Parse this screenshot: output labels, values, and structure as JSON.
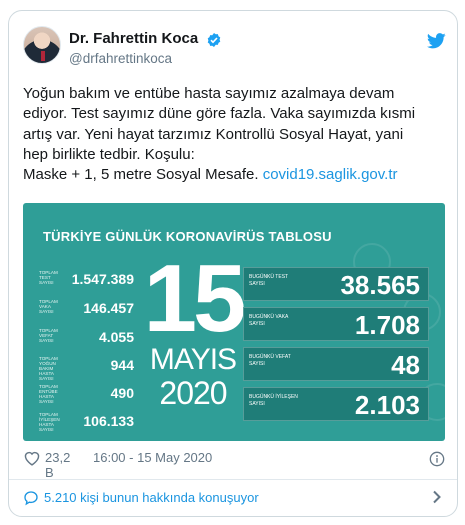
{
  "author": {
    "name": "Dr. Fahrettin Koca",
    "handle": "@drfahrettinkoca"
  },
  "tweet": {
    "lines": [
      "Yoğun bakım ve entübe hasta sayımız azalmaya devam",
      "ediyor. Test sayımız düne göre fazla. Vaka sayımızda kısmi",
      "artış var. Yeni hayat tarzımız Kontrollü Sosyal Hayat, yani",
      "hep birlikte tedbir. Koşulu:"
    ],
    "last_line_text": "Maske + 1, 5 metre Sosyal Mesafe. ",
    "link": "covid19.saglik.gov.tr"
  },
  "media": {
    "banner": "TÜRKİYE GÜNLÜK KORONAVİRÜS TABLOSU",
    "day": "15",
    "month": "MAYIS",
    "year": "2020",
    "left_stats": [
      {
        "label": "TOPLAM TEST SAYISI",
        "value": "1.547.389"
      },
      {
        "label": "TOPLAM VAKA SAYISI",
        "value": "146.457"
      },
      {
        "label": "TOPLAM VEFAT SAYISI",
        "value": "4.055"
      },
      {
        "label": "TOPLAM YOĞUN BAKIM HASTA SAYISI",
        "value": "944"
      },
      {
        "label": "TOPLAM ENTÜBE HASTA SAYISI",
        "value": "490"
      },
      {
        "label": "TOPLAM İYİLEŞEN HASTA SAYISI",
        "value": "106.133"
      }
    ],
    "right_stats": [
      {
        "label": "BUGÜNKÜ TEST SAYISI",
        "value": "38.565"
      },
      {
        "label": "BUGÜNKÜ VAKA SAYISI",
        "value": "1.708"
      },
      {
        "label": "BUGÜNKÜ VEFAT SAYISI",
        "value": "48"
      },
      {
        "label": "BUGÜNKÜ İYİLEŞEN SAYISI",
        "value": "2.103"
      }
    ]
  },
  "footer": {
    "likes": "23,2 B",
    "timestamp": "16:00 - 15 May 2020",
    "conversation": "5.210 kişi bunun hakkında konuşuyor"
  },
  "colors": {
    "link": "#1b95e0",
    "media_bg": "#2f9e97",
    "box_bg": "#1f7d78",
    "verified": "#1da1f2",
    "twitter_bird": "#1da1f2"
  },
  "icons": [
    "verified-badge-icon",
    "twitter-bird-icon",
    "heart-icon",
    "info-icon",
    "chat-bubble-icon",
    "chevron-right-icon"
  ]
}
